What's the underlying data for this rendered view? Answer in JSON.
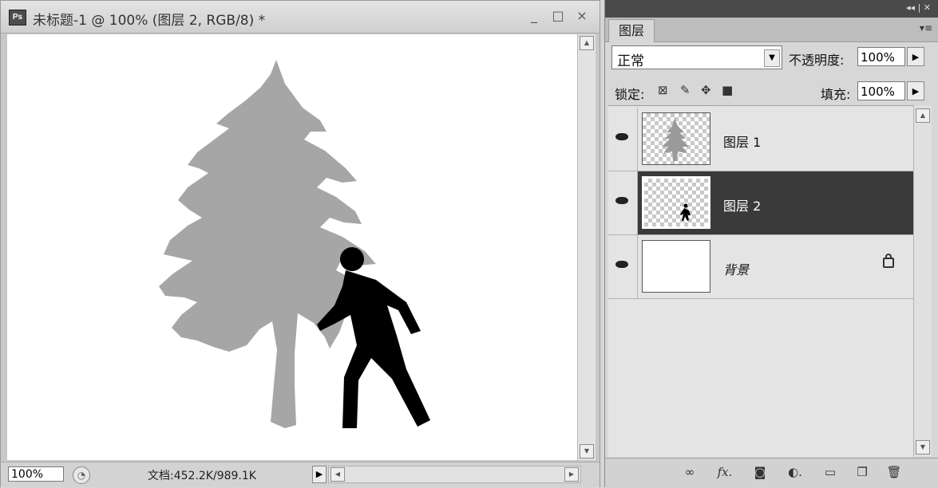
{
  "document": {
    "title": "未标题-1 @ 100% (图层 2, RGB/8) *",
    "app_icon": "Ps",
    "controls": [
      "_",
      "□",
      "×"
    ],
    "zoom": "100%",
    "doc_info": "文档:452.2K/989.1K",
    "status_arrow": "▶"
  },
  "panel": {
    "tab": "图层",
    "blend_mode": "正常",
    "opacity_label": "不透明度:",
    "opacity_value": "100%",
    "lock_label": "锁定:",
    "fill_label": "填充:",
    "fill_value": "100%",
    "layers": [
      {
        "name": "图层 1",
        "selected": false
      },
      {
        "name": "图层 2",
        "selected": true
      },
      {
        "name": "背景",
        "selected": false,
        "locked": true
      }
    ],
    "icons": [
      "link-icon",
      "fx-icon",
      "mask-icon",
      "adjustment-icon",
      "folder-icon",
      "new-layer-icon",
      "trash-icon"
    ]
  },
  "colors": {
    "tree": "#a6a6a6",
    "figure": "#000000",
    "selected_row": "#3a3a3a"
  }
}
